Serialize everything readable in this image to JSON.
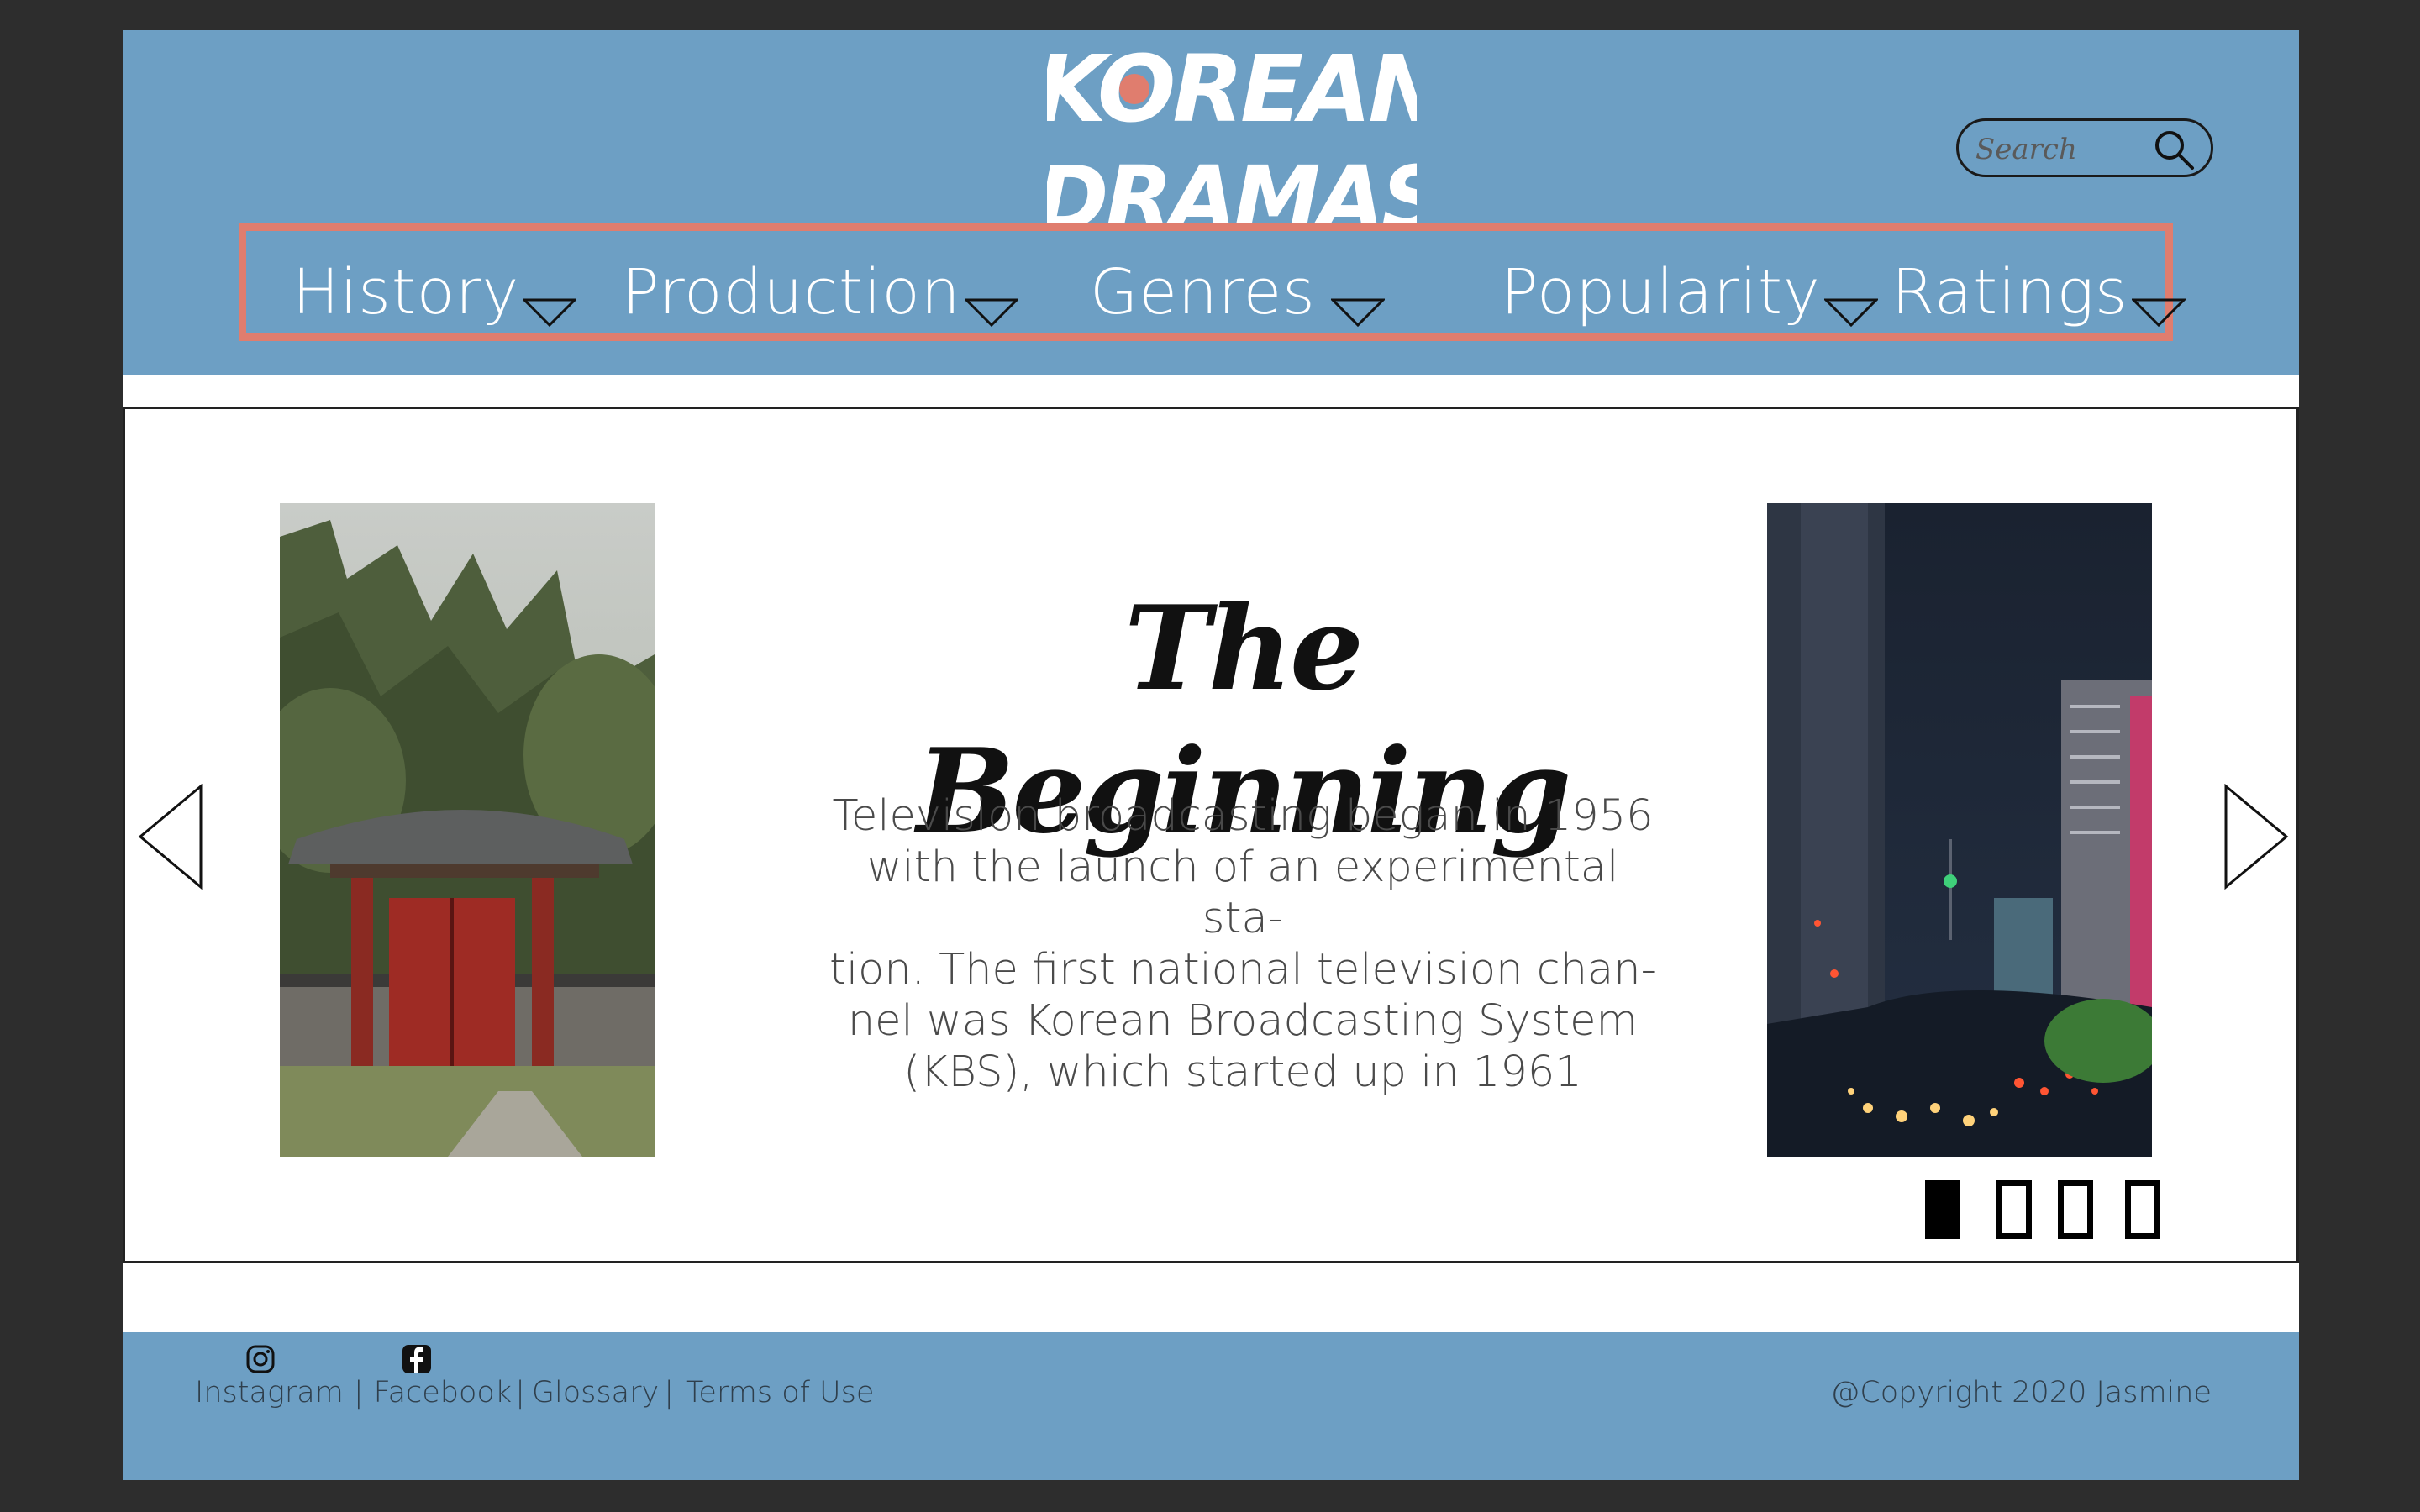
{
  "header": {
    "logo": {
      "line1": "KOREAN",
      "line2": "DRAMAS"
    },
    "search": {
      "placeholder": "Search"
    },
    "nav": [
      {
        "label": "History"
      },
      {
        "label": "Production"
      },
      {
        "label": "Genres"
      },
      {
        "label": "Popularity"
      },
      {
        "label": "Ratings"
      }
    ],
    "accent_color": "#e07d6e",
    "header_color": "#6d9fc4"
  },
  "carousel": {
    "title": "The Beginning",
    "body_lines": [
      "Television broadcasting began in 1956",
      "with the launch of an experimental sta-",
      "tion. The first national television chan-",
      "nel was Korean Broadcasting System",
      "(KBS), which started up in 1961"
    ],
    "left_image": "korean-gate-photo",
    "right_image": "seoul-night-street-photo",
    "prev_icon": "chevron-left-icon",
    "next_icon": "chevron-right-icon",
    "slide_count": 4,
    "active_slide": 1
  },
  "footer": {
    "links": [
      {
        "label": "Instagram"
      },
      {
        "label": "Facebook"
      },
      {
        "label": "Glossary"
      },
      {
        "label": "Terms of Use"
      }
    ],
    "icons": [
      "instagram-icon",
      "facebook-icon"
    ],
    "copyright": "@Copyright 2020 Jasmine"
  }
}
